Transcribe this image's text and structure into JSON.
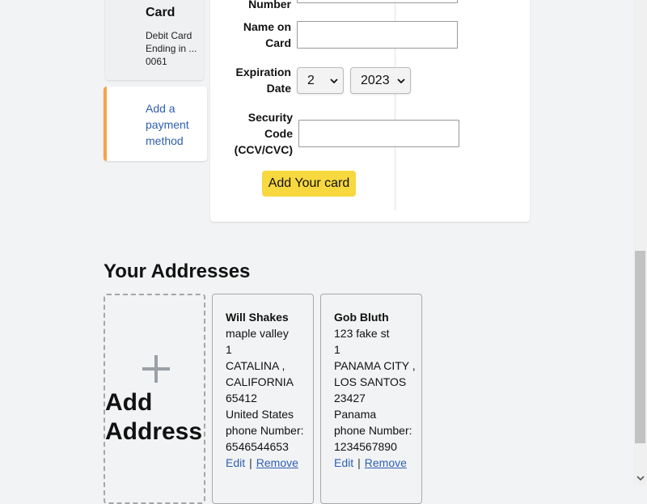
{
  "payment_methods": {
    "card": {
      "title": "Card",
      "description": "Debit Card Ending in ... 0061"
    },
    "add_link": "Add a payment method",
    "accent_color": "#f5a34a"
  },
  "card_form": {
    "number_label": "Number",
    "name_label": "Name on Card",
    "name_value": "",
    "expiration_label": "Expiration Date",
    "exp_month": "2",
    "exp_year": "2023",
    "security_label": "Security Code (CCV/CVC)",
    "security_value": "",
    "submit_label": "Add Your card",
    "submit_color": "#f7d83f"
  },
  "addresses": {
    "heading": "Your Addresses",
    "add_label": "Add Address",
    "items": [
      {
        "name": "Will Shakes",
        "line1": "maple valley",
        "line2": "1",
        "city_state": "CATALINA , CALIFORNIA",
        "zip": "65412",
        "country": "United States",
        "phone_label": "phone Number:",
        "phone": "6546544653",
        "edit": "Edit",
        "remove": "Remove"
      },
      {
        "name": "Gob Bluth",
        "line1": "123 fake st",
        "line2": "1",
        "city_state": "PANAMA CITY , LOS SANTOS",
        "zip": "23427",
        "country": "Panama",
        "phone_label": "phone Number:",
        "phone": "1234567890",
        "edit": "Edit",
        "remove": "Remove"
      }
    ],
    "separator": "|",
    "link_color": "#2f5fb3"
  }
}
